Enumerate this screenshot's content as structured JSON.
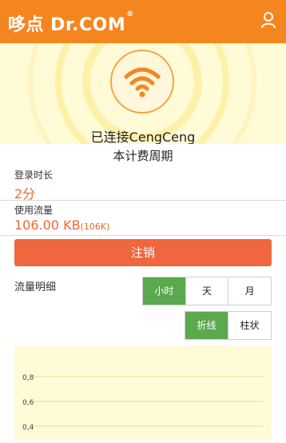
{
  "header": {
    "logo_text": "哆点 Dr.COM",
    "logo_reg": "®",
    "user_icon": "user-icon"
  },
  "status": {
    "connected_text": "已连接CengCeng",
    "wifi_icon": "wifi-icon",
    "accent_color": "#f5861f"
  },
  "billing": {
    "period_title": "本计费周期",
    "login_duration_label": "登录时长",
    "login_duration_value": "2分",
    "traffic_used_label": "使用流量",
    "traffic_used_value": "106.00 KB",
    "traffic_used_raw": "(106K)"
  },
  "logout_button": "注销",
  "detail": {
    "label": "流量明细",
    "period_options": [
      "小时",
      "天",
      "月"
    ],
    "period_selected": "小时",
    "mode_options": [
      "折线",
      "柱状"
    ],
    "mode_selected": "折线"
  },
  "chart_data": {
    "type": "line",
    "title": "",
    "xlabel": "",
    "ylabel": "",
    "y_ticks": [
      "0,8",
      "0,6",
      "0,4"
    ],
    "ylim": [
      0.3,
      0.9
    ],
    "series": [],
    "grid": true,
    "background": "#fffbd6"
  }
}
